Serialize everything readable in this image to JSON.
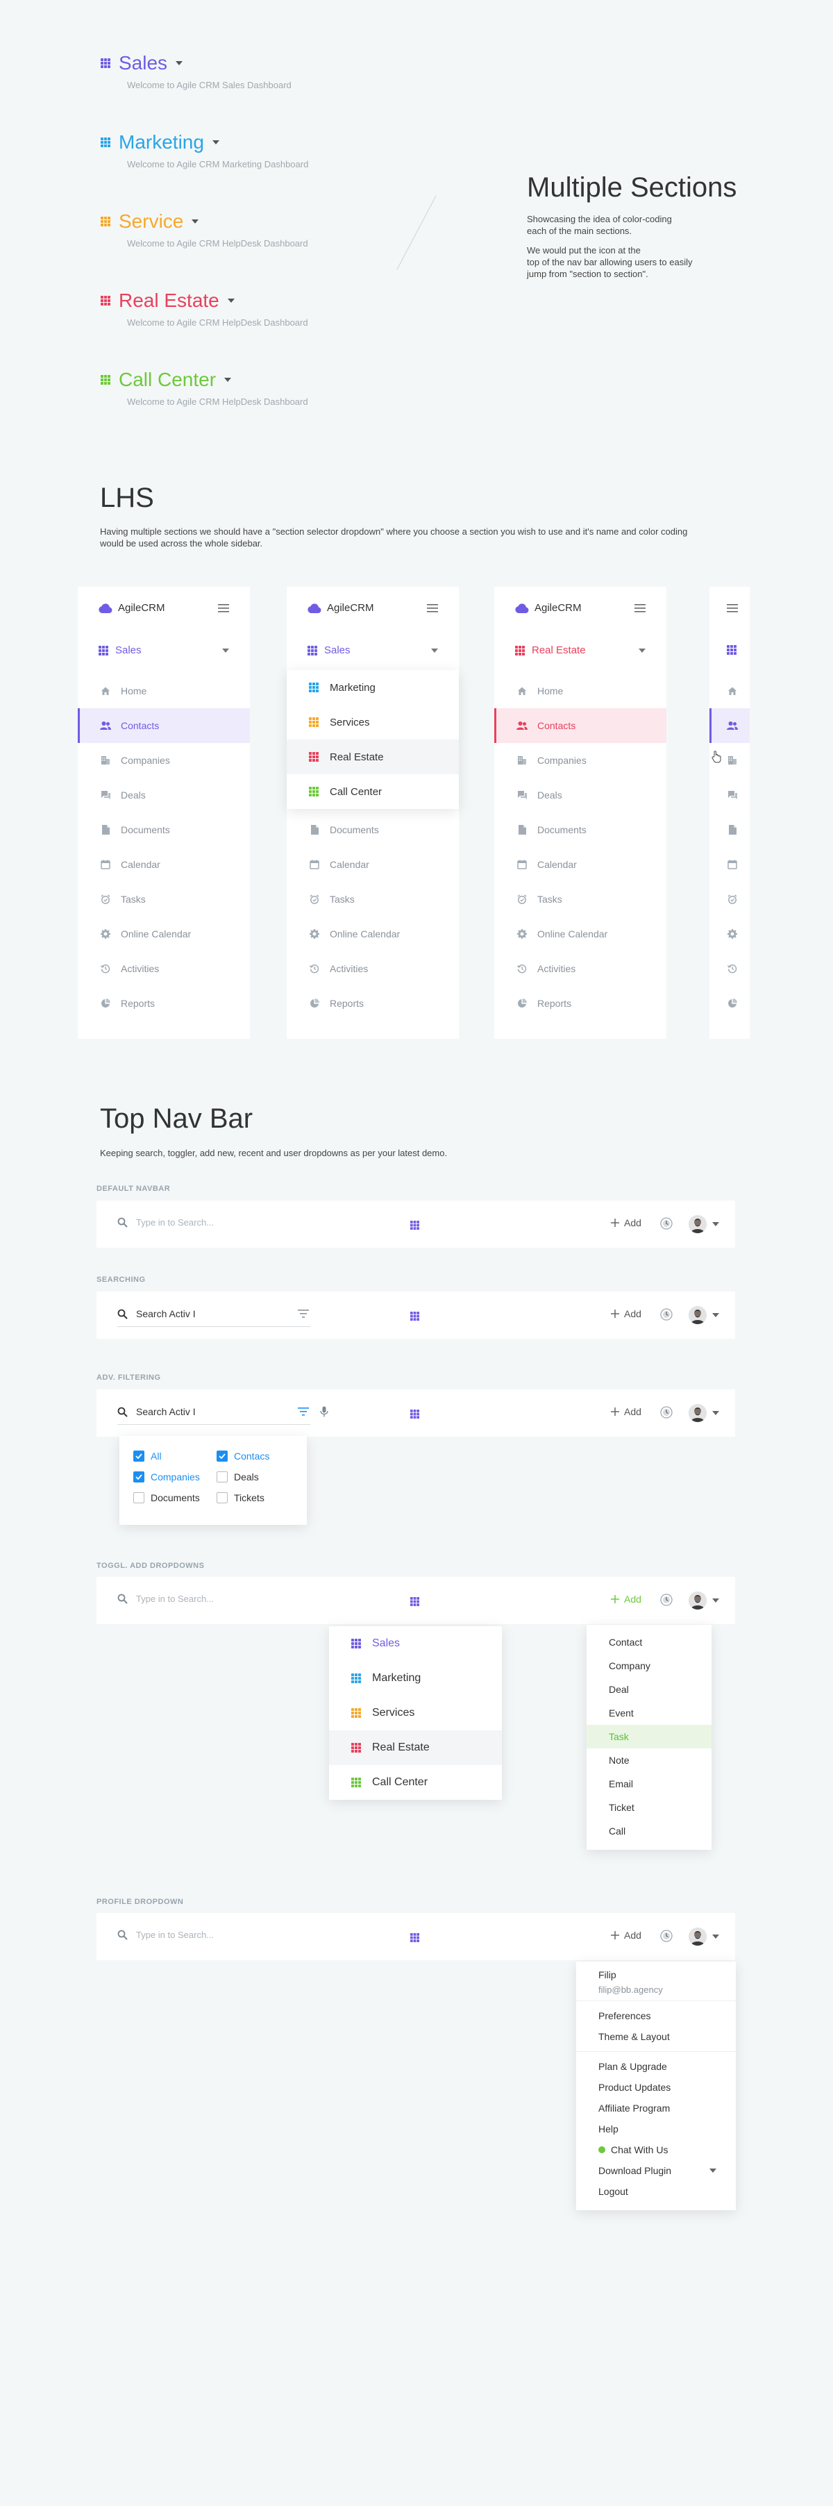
{
  "colors": {
    "sales": "#6f5ce4",
    "marketing": "#2aa4e8",
    "service": "#f6a92a",
    "realestate": "#e9405d",
    "callcenter": "#6dc93b"
  },
  "sections": [
    {
      "title": "Sales",
      "subtitle": "Welcome to Agile CRM Sales Dashboard",
      "color": "#6f5ce4"
    },
    {
      "title": "Marketing",
      "subtitle": "Welcome to Agile CRM Marketing Dashboard",
      "color": "#2aa4e8"
    },
    {
      "title": "Service",
      "subtitle": "Welcome to Agile CRM HelpDesk Dashboard",
      "color": "#f6a92a"
    },
    {
      "title": "Real Estate",
      "subtitle": "Welcome to Agile CRM HelpDesk Dashboard",
      "color": "#e9405d"
    },
    {
      "title": "Call Center",
      "subtitle": "Welcome to Agile CRM HelpDesk Dashboard",
      "color": "#6dc93b"
    }
  ],
  "multiple": {
    "title": "Multiple Sections",
    "p1": "Showcasing the idea of color-coding",
    "p2": "each of the main sections.",
    "p3": "We would put the icon at the",
    "p4": "top of the nav bar allowing users to easily",
    "p5": "jump from \"section to section\"."
  },
  "lhs": {
    "title": "LHS",
    "desc1": "Having multiple sections we should have a \"section selector dropdown\" where you choose a section you wish to use and it's name and color coding",
    "desc2": "would be used across the whole sidebar."
  },
  "sidebar": {
    "brand": "AgileCRM",
    "items": [
      "Home",
      "Contacts",
      "Companies",
      "Deals",
      "Documents",
      "Calendar",
      "Tasks",
      "Online Calendar",
      "Activities",
      "Reports"
    ]
  },
  "sidebar1": {
    "section": "Sales"
  },
  "sidebar2": {
    "section": "Sales",
    "dropdown": [
      "Marketing",
      "Services",
      "Real Estate",
      "Call Center"
    ]
  },
  "sidebar3": {
    "section": "Real Estate"
  },
  "topnav": {
    "title": "Top Nav Bar",
    "desc": "Keeping search, toggler, add new, recent and user dropdowns as per your latest demo.",
    "label_default": "DEFAULT NAVBAR",
    "label_searching": "SEARCHING",
    "label_adv": "ADV. FILTERING",
    "label_toggl": "TOGGL. ADD DROPDOWNS",
    "label_profile": "PROFILE DROPDOWN",
    "search_placeholder": "Type in to Search...",
    "search_value": "Search Activ I",
    "add_label": "Add"
  },
  "filters": {
    "col1": [
      {
        "label": "All",
        "checked": true
      },
      {
        "label": "Companies",
        "checked": true
      },
      {
        "label": "Documents",
        "checked": false
      }
    ],
    "col2": [
      {
        "label": "Contacs",
        "checked": true
      },
      {
        "label": "Deals",
        "checked": false
      },
      {
        "label": "Tickets",
        "checked": false
      }
    ]
  },
  "section_dropdown": [
    "Sales",
    "Marketing",
    "Services",
    "Real Estate",
    "Call Center"
  ],
  "add_dropdown": [
    "Contact",
    "Company",
    "Deal",
    "Event",
    "Task",
    "Note",
    "Email",
    "Ticket",
    "Call"
  ],
  "profile": {
    "name": "Filip",
    "email": "filip@bb.agency",
    "group1": [
      "Preferences",
      "Theme & Layout"
    ],
    "group2": [
      "Plan & Upgrade",
      "Product Updates",
      "Affiliate Program",
      "Help"
    ],
    "chat": "Chat With Us",
    "download": "Download Plugin",
    "logout": "Logout"
  }
}
